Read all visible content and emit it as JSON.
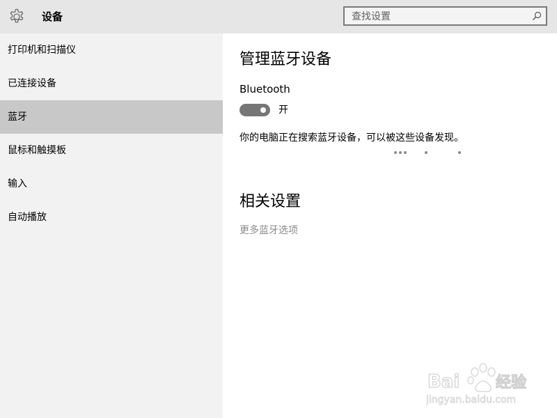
{
  "header": {
    "app_title": "设备",
    "settings_icon": "gear-icon",
    "search": {
      "placeholder": "查找设置",
      "value": "",
      "icon": "search-icon"
    }
  },
  "sidebar": {
    "items": [
      {
        "label": "打印机和扫描仪",
        "selected": false
      },
      {
        "label": "已连接设备",
        "selected": false
      },
      {
        "label": "蓝牙",
        "selected": true
      },
      {
        "label": "鼠标和触摸板",
        "selected": false
      },
      {
        "label": "输入",
        "selected": false
      },
      {
        "label": "自动播放",
        "selected": false
      }
    ]
  },
  "main": {
    "title": "管理蓝牙设备",
    "bluetooth_label": "Bluetooth",
    "toggle": {
      "state_label": "开",
      "on": true
    },
    "status_text": "你的电脑正在搜索蓝牙设备，可以被这些设备发现。",
    "progress_indicator": "searching-dots",
    "related": {
      "title": "相关设置",
      "more_link": "更多蓝牙选项"
    }
  },
  "watermark": {
    "brand_text": "Bai 经验",
    "url_text": "jingyan.baidu.com"
  },
  "colors": {
    "header_bg": "#e6e6e6",
    "sidebar_bg": "#f2f2f2",
    "selected_bg": "#c8c8c8",
    "toggle_on": "#767676",
    "muted_text": "#8a8a8a"
  }
}
